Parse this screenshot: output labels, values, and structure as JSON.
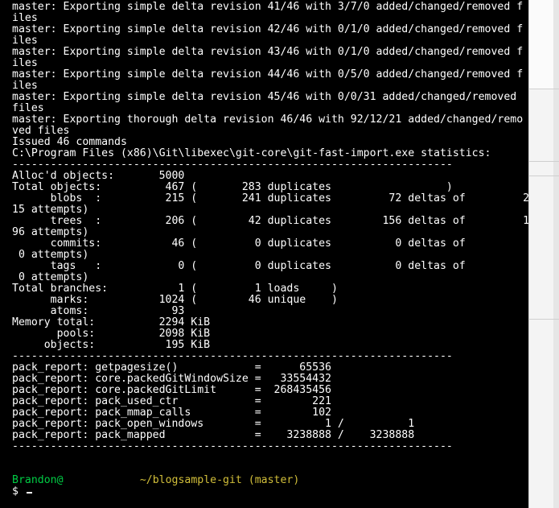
{
  "terminal": {
    "lines": [
      "master: Exporting simple delta revision 41/46 with 3/7/0 added/changed/removed f",
      "iles",
      "master: Exporting simple delta revision 42/46 with 0/1/0 added/changed/removed f",
      "iles",
      "master: Exporting simple delta revision 43/46 with 0/1/0 added/changed/removed f",
      "iles",
      "master: Exporting simple delta revision 44/46 with 0/5/0 added/changed/removed f",
      "iles",
      "master: Exporting simple delta revision 45/46 with 0/0/31 added/changed/removed",
      "files",
      "master: Exporting thorough delta revision 46/46 with 92/12/21 added/changed/remo",
      "ved files",
      "Issued 46 commands",
      "C:\\Program Files (x86)\\Git\\libexec\\git-core\\git-fast-import.exe statistics:",
      "---------------------------------------------------------------------",
      "Alloc'd objects:       5000",
      "Total objects:          467 (       283 duplicates                  )",
      "      blobs  :          215 (       241 duplicates         72 deltas of         2",
      "15 attempts)",
      "      trees  :          206 (        42 duplicates        156 deltas of         1",
      "96 attempts)",
      "      commits:           46 (         0 duplicates          0 deltas of",
      " 0 attempts)",
      "      tags   :            0 (         0 duplicates          0 deltas of",
      " 0 attempts)",
      "Total branches:           1 (         1 loads     )",
      "      marks:           1024 (        46 unique    )",
      "      atoms:             93",
      "Memory total:          2294 KiB",
      "       pools:          2098 KiB",
      "     objects:           195 KiB",
      "---------------------------------------------------------------------",
      "pack_report: getpagesize()            =      65536",
      "pack_report: core.packedGitWindowSize =   33554432",
      "pack_report: core.packedGitLimit      =  268435456",
      "pack_report: pack_used_ctr            =        221",
      "pack_report: pack_mmap_calls          =        102",
      "pack_report: pack_open_windows        =          1 /          1",
      "pack_report: pack_mapped              =    3238888 /    3238888",
      "---------------------------------------------------------------------",
      ""
    ],
    "prompt": {
      "user": "Brandon@",
      "gap": "            ",
      "path": "~/blogsample-git (master)",
      "symbol": "$ "
    }
  },
  "colors": {
    "background": "#000000",
    "text": "#ffffff",
    "prompt_user": "#00cc44",
    "prompt_path": "#d2bf3a"
  }
}
